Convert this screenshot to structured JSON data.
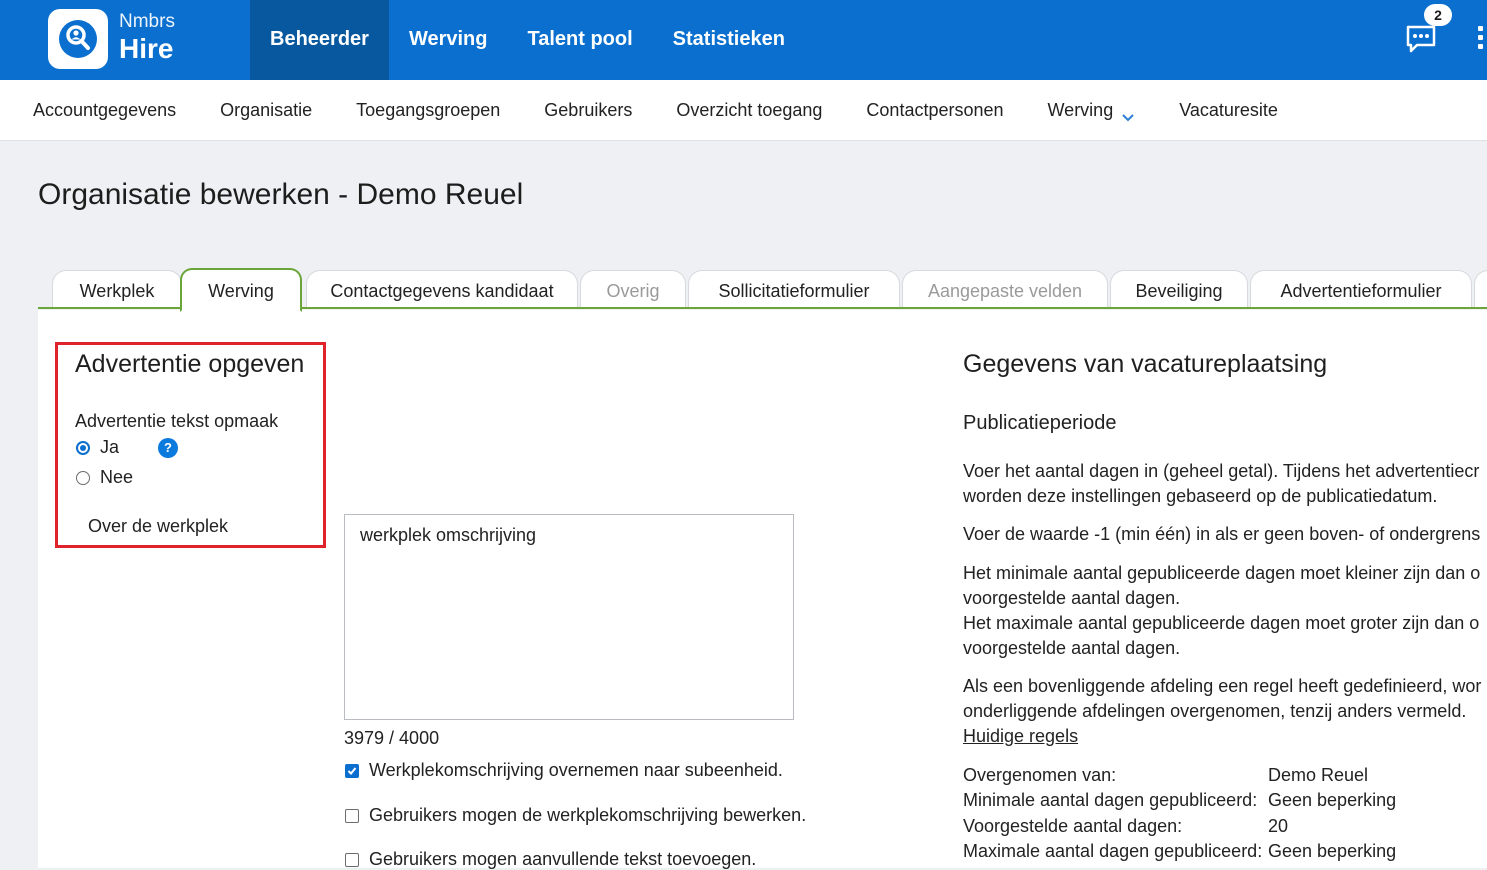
{
  "brand": {
    "name": "Nmbrs",
    "product": "Hire",
    "color": "#0a6fcf"
  },
  "nav_main": [
    {
      "label": "Beheerder",
      "active": true
    },
    {
      "label": "Werving"
    },
    {
      "label": "Talent pool"
    },
    {
      "label": "Statistieken"
    }
  ],
  "chat": {
    "icon": "chat-bubble-icon",
    "badge": "2"
  },
  "subnav": [
    {
      "label": "Accountgegevens"
    },
    {
      "label": "Organisatie"
    },
    {
      "label": "Toegangsgroepen"
    },
    {
      "label": "Gebruikers"
    },
    {
      "label": "Overzicht toegang"
    },
    {
      "label": "Contactpersonen"
    },
    {
      "label": "Werving",
      "dropdown": true
    },
    {
      "label": "Vacaturesite"
    }
  ],
  "page_title": "Organisatie bewerken - Demo Reuel",
  "tabs": [
    {
      "label": "Werkplek"
    },
    {
      "label": "Werving",
      "active": true
    },
    {
      "label": "Contactgegevens kandidaat"
    },
    {
      "label": "Overig",
      "disabled": true
    },
    {
      "label": "Sollicitatieformulier"
    },
    {
      "label": "Aangepaste velden",
      "disabled": true
    },
    {
      "label": "Beveiliging"
    },
    {
      "label": "Advertentieformulier"
    }
  ],
  "advert": {
    "heading": "Advertentie opgeven",
    "format_label": "Advertentie tekst opmaak",
    "option_yes": "Ja",
    "option_no": "Nee",
    "selected": "Ja",
    "about_label": "Over de werkplek",
    "textarea_value": "werkplek omschrijving",
    "char_count": "3979 / 4000",
    "checkboxes": [
      {
        "label": "Werkplekomschrijving overnemen naar subeenheid.",
        "checked": true
      },
      {
        "label": "Gebruikers mogen de werkplekomschrijving bewerken.",
        "checked": false
      },
      {
        "label": "Gebruikers mogen aanvullende tekst toevoegen.",
        "checked": false
      }
    ]
  },
  "vacancy": {
    "heading": "Gegevens van vacatureplaatsing",
    "subheading": "Publicatieperiode",
    "p1_line1": "Voer het aantal dagen in (geheel getal). Tijdens het advertentiecr",
    "p1_line2": "worden deze instellingen gebaseerd op de publicatiedatum.",
    "p2": "Voer de waarde -1 (min één) in als er geen boven- of ondergrens",
    "p3_line1": "Het minimale aantal gepubliceerde dagen moet kleiner zijn dan o",
    "p3_line2": "voorgestelde aantal dagen.",
    "p3_line3": "Het maximale aantal gepubliceerde dagen moet groter zijn dan o",
    "p3_line4": "voorgestelde aantal dagen.",
    "p4_line1": "Als een bovenliggende afdeling een regel heeft gedefinieerd, wor",
    "p4_line2": "onderliggende afdelingen overgenomen, tenzij anders vermeld.",
    "rules_link": "Huidige regels",
    "rows": [
      {
        "key": "Overgenomen van:",
        "value": "Demo Reuel"
      },
      {
        "key": "Minimale aantal dagen gepubliceerd:",
        "value": "Geen beperking"
      },
      {
        "key": "Voorgestelde aantal dagen:",
        "value": "20"
      },
      {
        "key": "Maximale aantal dagen gepubliceerd:",
        "value": "Geen beperking"
      }
    ]
  }
}
